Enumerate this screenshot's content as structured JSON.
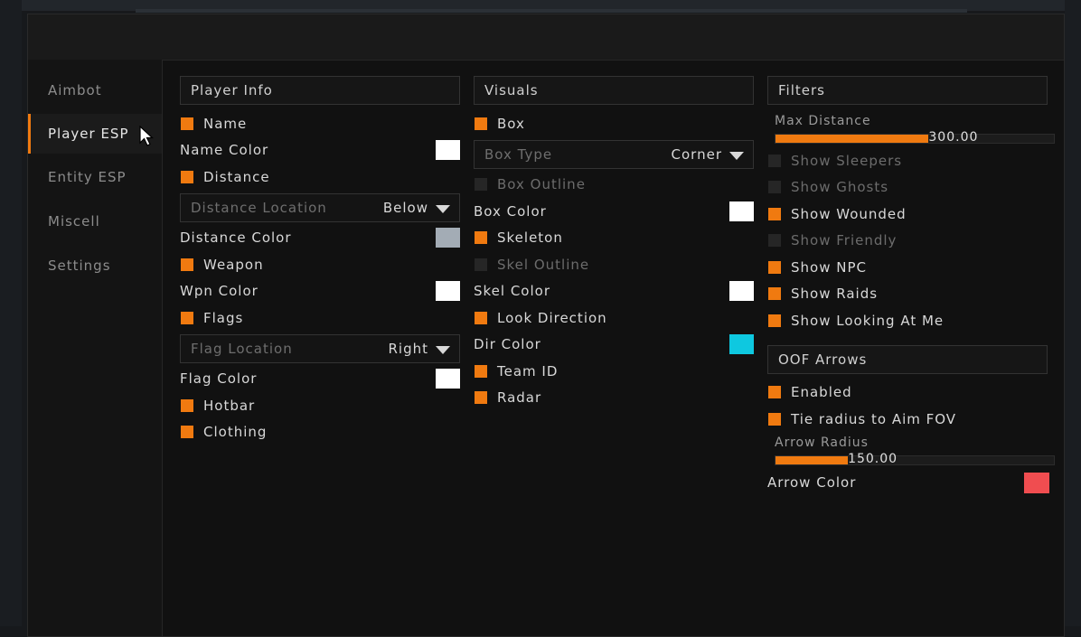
{
  "colors": {
    "accent": "#f07a10",
    "white": "#ffffff",
    "gray": "#a3acb5",
    "cyan": "#0ec8e0",
    "red": "#f04d50"
  },
  "sidebar": {
    "items": [
      {
        "label": "Aimbot",
        "active": false
      },
      {
        "label": "Player ESP",
        "active": true
      },
      {
        "label": "Entity ESP",
        "active": false
      },
      {
        "label": "Miscell",
        "active": false
      },
      {
        "label": "Settings",
        "active": false
      }
    ]
  },
  "player_info": {
    "title": "Player Info",
    "name": "Name",
    "name_color": "Name Color",
    "distance": "Distance",
    "distance_location": {
      "label": "Distance Location",
      "value": "Below"
    },
    "distance_color": "Distance Color",
    "weapon": "Weapon",
    "wpn_color": "Wpn Color",
    "flags": "Flags",
    "flag_location": {
      "label": "Flag Location",
      "value": "Right"
    },
    "flag_color": "Flag Color",
    "hotbar": "Hotbar",
    "clothing": "Clothing"
  },
  "visuals": {
    "title": "Visuals",
    "box": "Box",
    "box_type": {
      "label": "Box Type",
      "value": "Corner"
    },
    "box_outline": "Box Outline",
    "box_color": "Box Color",
    "skeleton": "Skeleton",
    "skel_outline": "Skel Outline",
    "skel_color": "Skel Color",
    "look_direction": "Look Direction",
    "dir_color": "Dir Color",
    "team_id": "Team ID",
    "radar": "Radar"
  },
  "filters": {
    "title": "Filters",
    "max_distance": {
      "label": "Max Distance",
      "value": "300.00",
      "fraction": 0.55
    },
    "show_sleepers": "Show Sleepers",
    "show_ghosts": "Show Ghosts",
    "show_wounded": "Show Wounded",
    "show_friendly": "Show Friendly",
    "show_npc": "Show NPC",
    "show_raids": "Show Raids",
    "show_looking_at_me": "Show Looking At Me"
  },
  "oof_arrows": {
    "title": "OOF Arrows",
    "enabled": "Enabled",
    "tie_radius": "Tie radius to Aim FOV",
    "arrow_radius": {
      "label": "Arrow Radius",
      "value": "150.00",
      "fraction": 0.26
    },
    "arrow_color": "Arrow Color"
  }
}
